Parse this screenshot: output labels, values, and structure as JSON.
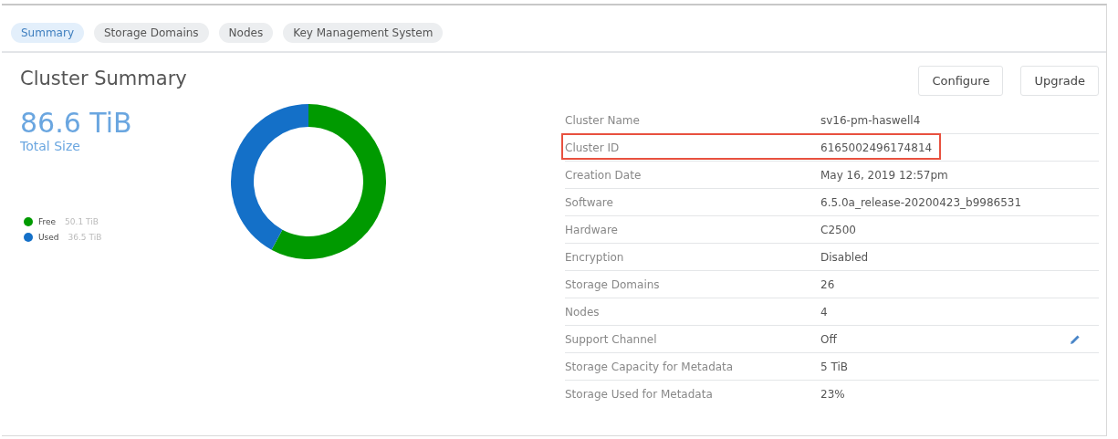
{
  "tabs": [
    {
      "label": "Summary",
      "selected": true
    },
    {
      "label": "Storage Domains",
      "selected": false
    },
    {
      "label": "Nodes",
      "selected": false
    },
    {
      "label": "Key Management System",
      "selected": false
    }
  ],
  "title": "Cluster Summary",
  "total": {
    "value": "86.6 TiB",
    "label": "Total Size"
  },
  "legend": [
    {
      "value": "50.1 TiB",
      "color": "#009a00"
    },
    {
      "value": "36.5 TiB",
      "color": "#1470c8"
    }
  ],
  "chart_data": {
    "type": "donut",
    "categories": [
      "Free",
      "Used"
    ],
    "values": [
      57.9,
      42.1
    ]
  },
  "buttons": [
    "Configure",
    "Upgrade"
  ],
  "details": [
    {
      "label": "Cluster Name",
      "value": "sv16-pm-haswell4",
      "highlighted": false,
      "editable": false
    },
    {
      "label": "Cluster ID",
      "value": "6165002496174814",
      "highlighted": true,
      "editable": false
    },
    {
      "label": "Creation Date",
      "value": "May 16, 2019 12:57pm",
      "highlighted": false,
      "editable": false
    },
    {
      "label": "Software",
      "value": "6.5.0a_release-20200423_b9986531",
      "highlighted": false,
      "editable": false
    },
    {
      "label": "Hardware",
      "value": "C2500",
      "highlighted": false,
      "editable": false
    },
    {
      "label": "Encryption",
      "value": "Disabled",
      "highlighted": false,
      "editable": false
    },
    {
      "label": "Storage Domains",
      "value": "26",
      "highlighted": false,
      "editable": false
    },
    {
      "label": "Nodes",
      "value": "4",
      "highlighted": false,
      "editable": false
    },
    {
      "label": "Support Channel",
      "value": "Off",
      "highlighted": false,
      "editable": true
    },
    {
      "label": "Storage Capacity for Metadata",
      "value": "5 TiB",
      "highlighted": false,
      "editable": false
    },
    {
      "label": "Storage Used for Metadata",
      "value": "23%",
      "highlighted": false,
      "editable": false
    }
  ]
}
